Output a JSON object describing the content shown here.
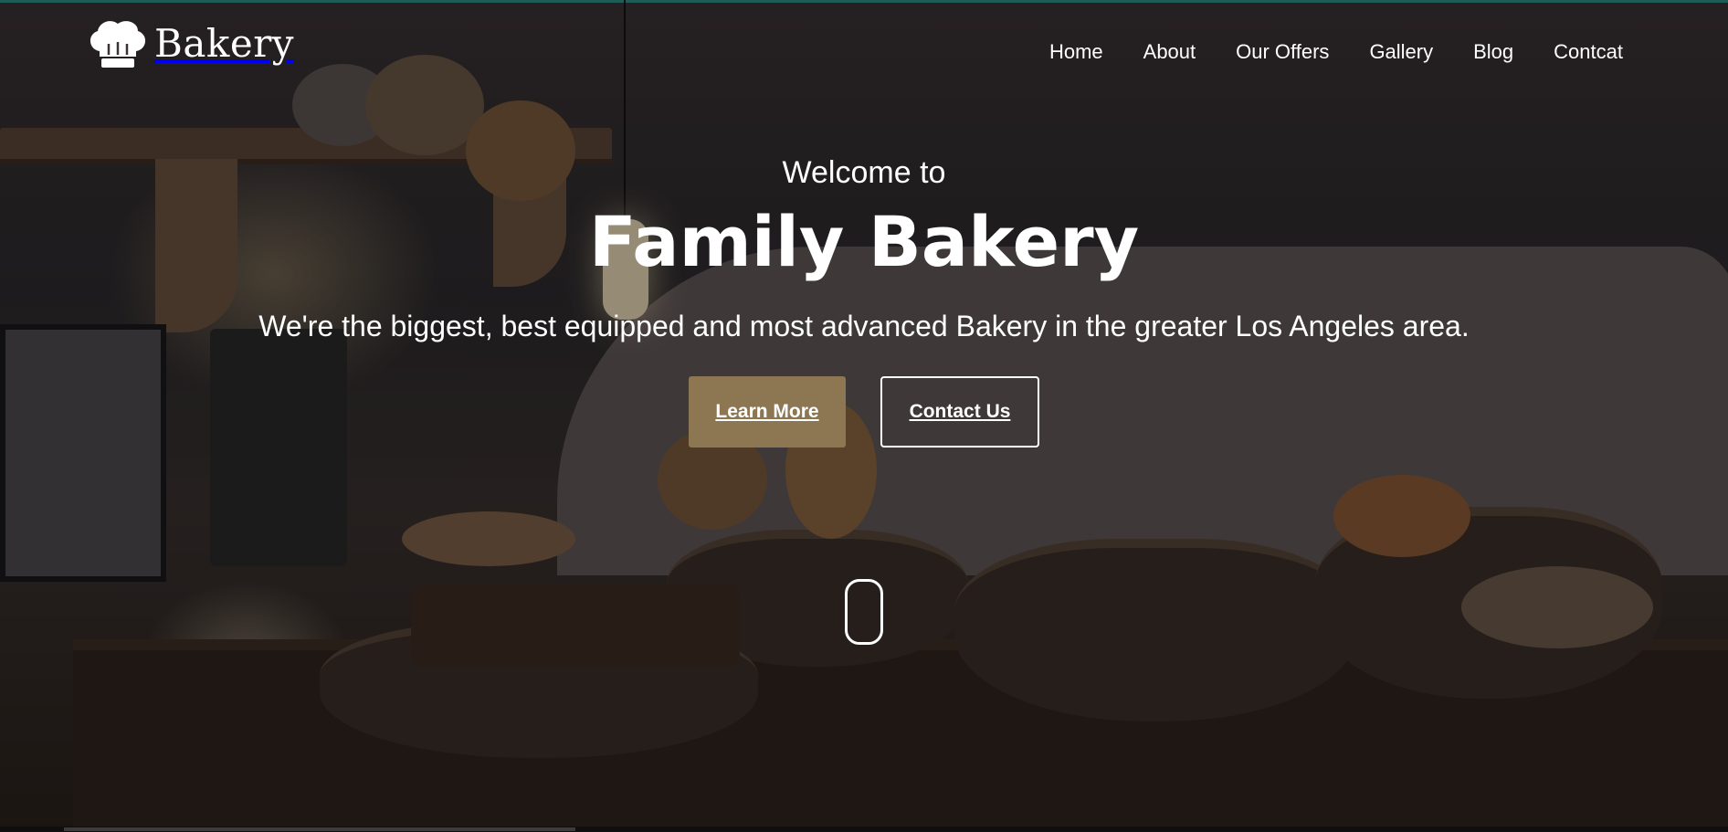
{
  "brand": {
    "name": "Bakery",
    "icon": "chef-hat-icon"
  },
  "nav": {
    "items": [
      "Home",
      "About",
      "Our Offers",
      "Gallery",
      "Blog",
      "Contcat"
    ]
  },
  "hero": {
    "welcome": "Welcome to",
    "title": "Family Bakery",
    "subtitle": "We're the biggest, best equipped and most advanced Bakery in the greater Los Angeles area.",
    "primary_button": "Learn More",
    "secondary_button": "Contact Us",
    "scroll_indicator_icon": "mouse-scroll-icon"
  },
  "colors": {
    "accent": "#8c7752",
    "text": "#ffffff",
    "top_line": "#2e8f86"
  }
}
